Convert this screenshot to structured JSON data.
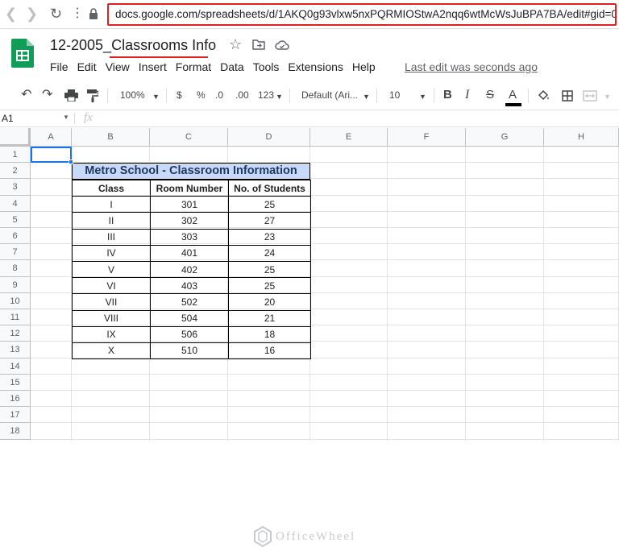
{
  "browser": {
    "back_icon": "chevron-left-icon",
    "forward_icon": "chevron-right-icon",
    "reload_icon": "reload-icon",
    "url": "docs.google.com/spreadsheets/d/1AKQ0g93vlxw5nxPQRMIOStwA2nqq6wtMcWsJuBPA7BA/edit#gid=0",
    "url_highlight_color": "#e02020"
  },
  "document": {
    "title": "12-2005_Classrooms Info",
    "last_edit": "Last edit was seconds ago"
  },
  "menu": [
    "File",
    "Edit",
    "View",
    "Insert",
    "Format",
    "Data",
    "Tools",
    "Extensions",
    "Help"
  ],
  "toolbar": {
    "zoom": "100%",
    "currency": "$",
    "percent": "%",
    "decrease_decimal": ".0",
    "increase_decimal": ".00",
    "more_formats": "123",
    "font": "Default (Ari...",
    "font_size": "10",
    "bold": "B",
    "italic": "I",
    "strikethrough": "S",
    "text_color": "A"
  },
  "formula_bar": {
    "name_box": "A1",
    "fx": "fx"
  },
  "columns": [
    "A",
    "B",
    "C",
    "D",
    "E",
    "F",
    "G",
    "H"
  ],
  "rows": [
    "1",
    "2",
    "3",
    "4",
    "5",
    "6",
    "7",
    "8",
    "9",
    "10",
    "11",
    "12",
    "13",
    "14",
    "15",
    "16",
    "17",
    "18"
  ],
  "table": {
    "title": "Metro School - Classroom Information",
    "title_bg": "#c9daf8",
    "headers": [
      "Class",
      "Room Number",
      "No. of Students"
    ],
    "rows": [
      [
        "I",
        "301",
        "25"
      ],
      [
        "II",
        "302",
        "27"
      ],
      [
        "III",
        "303",
        "23"
      ],
      [
        "IV",
        "401",
        "24"
      ],
      [
        "V",
        "402",
        "25"
      ],
      [
        "VI",
        "403",
        "25"
      ],
      [
        "VII",
        "502",
        "20"
      ],
      [
        "VIII",
        "504",
        "21"
      ],
      [
        "IX",
        "506",
        "18"
      ],
      [
        "X",
        "510",
        "16"
      ]
    ]
  },
  "watermark": "OfficeWheel",
  "accent_color": "#1a73e8"
}
